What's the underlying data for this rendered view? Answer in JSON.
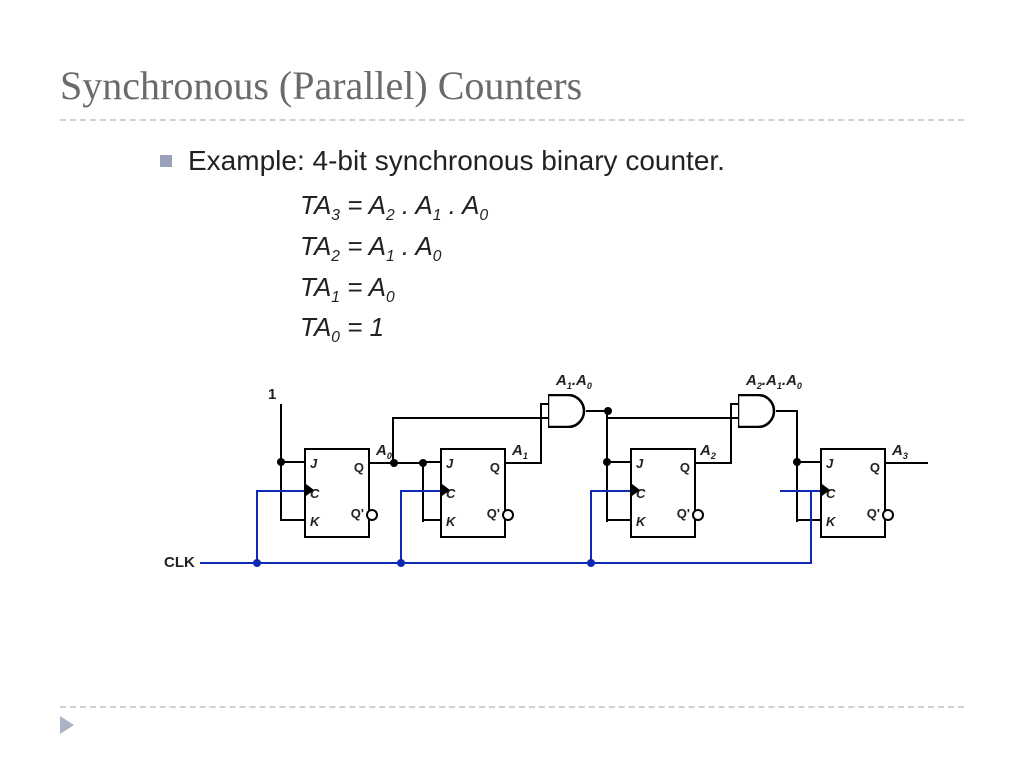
{
  "title": "Synchronous (Parallel) Counters",
  "bullet": "Example: 4-bit synchronous binary counter.",
  "equations": {
    "ta3": {
      "lhs": "TA",
      "lhs_sub": "3",
      "rhs": "A₂ . A₁ . A₀"
    },
    "ta2": {
      "lhs": "TA",
      "lhs_sub": "2",
      "rhs": "A₁ . A₀"
    },
    "ta1": {
      "lhs": "TA",
      "lhs_sub": "1",
      "rhs": "A₀"
    },
    "ta0": {
      "lhs": "TA",
      "lhs_sub": "0",
      "rhs": "1"
    }
  },
  "circuit": {
    "input_const": "1",
    "clk_label": "CLK",
    "ff_labels": {
      "J": "J",
      "C": "C",
      "K": "K",
      "Q": "Q",
      "Qp": "Q'"
    },
    "outputs": {
      "A0": "A",
      "A0s": "0",
      "A1": "A",
      "A1s": "1",
      "A2": "A",
      "A2s": "2",
      "A3": "A",
      "A3s": "3"
    },
    "and_labels": {
      "g1": "A₁.A₀",
      "g2": "A₂.A₁.A₀"
    }
  }
}
